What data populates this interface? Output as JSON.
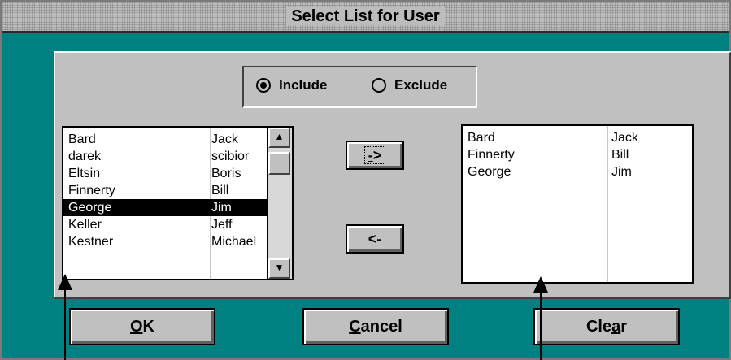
{
  "window": {
    "title": "Select List for User"
  },
  "filter": {
    "options": [
      {
        "label": "Include",
        "selected": true
      },
      {
        "label": "Exclude",
        "selected": false
      }
    ]
  },
  "available_list": {
    "rows": [
      {
        "last": "Bard",
        "first": "Jack",
        "selected": false
      },
      {
        "last": "darek",
        "first": "scibior",
        "selected": false
      },
      {
        "last": "Eltsin",
        "first": "Boris",
        "selected": false
      },
      {
        "last": "Finnerty",
        "first": "Bill",
        "selected": false
      },
      {
        "last": "George",
        "first": "Jim",
        "selected": true
      },
      {
        "last": "Keller",
        "first": "Jeff",
        "selected": false
      },
      {
        "last": "Kestner",
        "first": "Michael",
        "selected": false
      }
    ]
  },
  "selected_list": {
    "rows": [
      {
        "last": "Bard",
        "first": "Jack"
      },
      {
        "last": "Finnerty",
        "first": "Bill"
      },
      {
        "last": "George",
        "first": "Jim"
      }
    ]
  },
  "move": {
    "add_pre": "",
    "add_key": "-",
    "add_post": ">",
    "remove_pre": "",
    "remove_key": "<",
    "remove_post": "-"
  },
  "buttons": {
    "ok_pre": "",
    "ok_key": "O",
    "ok_post": "K",
    "cancel_pre": "",
    "cancel_key": "C",
    "cancel_post": "ancel",
    "clear_pre": "Cle",
    "clear_key": "a",
    "clear_post": "r"
  },
  "scroll": {
    "up_icon": "▲",
    "down_icon": "▼"
  },
  "colors": {
    "dialog": "#008080",
    "panel": "#c0c0c0",
    "selection": "#000000"
  }
}
